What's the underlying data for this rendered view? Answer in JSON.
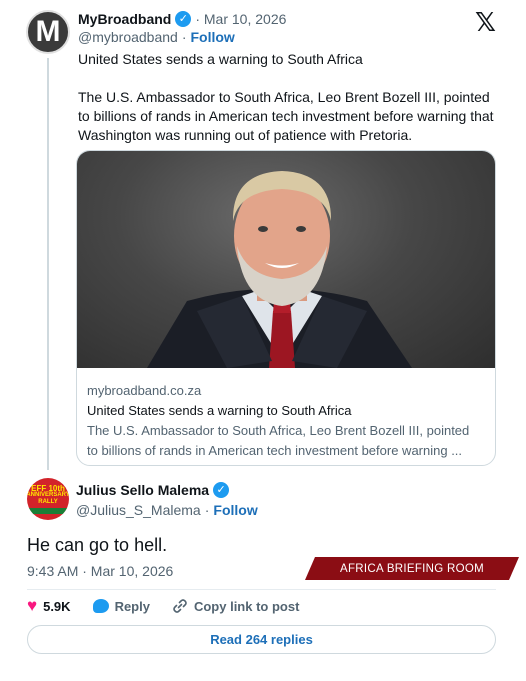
{
  "quoted_tweet": {
    "avatar_letter": "M",
    "display_name": "MyBroadband",
    "date": "· Mar 10, 2026",
    "handle": "@mybroadband",
    "separator": "·",
    "follow_label": "Follow",
    "text_line1": "United States sends a warning to South Africa",
    "text_body": "The U.S. Ambassador to South Africa, Leo Brent Bozell III, pointed to billions of rands in American tech investment before warning that Washington was running out of patience with Pretoria.",
    "card": {
      "domain": "mybroadband.co.za",
      "title": "United States sends a warning to South Africa",
      "description_line1": "The U.S. Ambassador to South Africa, Leo Brent Bozell III, pointed",
      "description_line2": "to billions of rands in American tech investment before warning ..."
    }
  },
  "platform_logo": "𝕏",
  "main_tweet": {
    "avatar_text_top": "EFF 10th",
    "avatar_text_mid": "ANNIVERSARY RALLY",
    "display_name": "Julius Sello Malema",
    "handle": "@Julius_S_Malema",
    "separator": "·",
    "follow_label": "Follow",
    "text": "He can go to hell.",
    "timestamp": "9:43 AM · Mar 10, 2026",
    "likes": "5.9K",
    "reply_label": "Reply",
    "copy_link_label": "Copy link to post",
    "read_replies_label": "Read 264 replies"
  },
  "watermark": "AFRICA BRIEFING ROOM",
  "icons": {
    "verified": "✓",
    "heart": "♥",
    "link": "🔗"
  },
  "colors": {
    "accent_blue": "#1d9bf0",
    "link_blue": "#1d6fb8",
    "like_pink": "#f91880",
    "watermark_red": "#8b0d14",
    "muted_text": "#536471"
  }
}
